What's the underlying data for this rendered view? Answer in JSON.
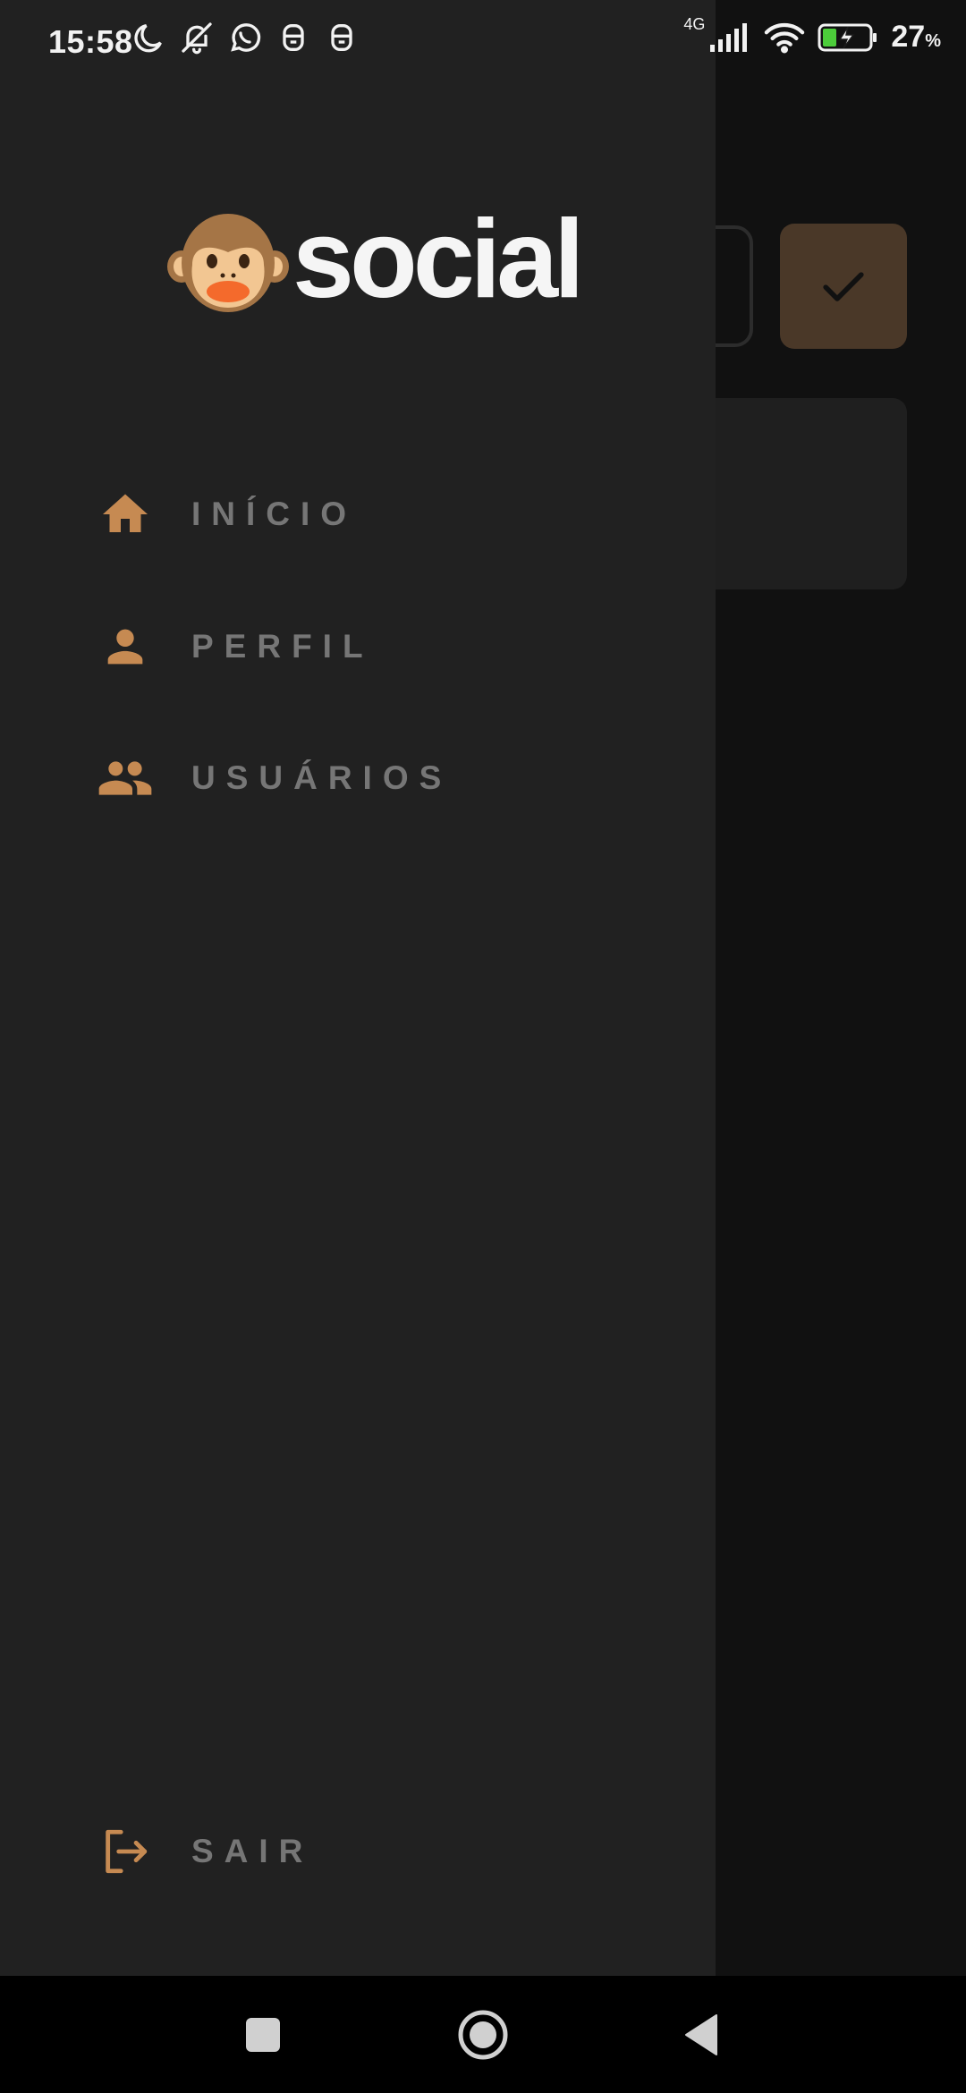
{
  "status_bar": {
    "time": "15:58",
    "network": "4G",
    "battery_percent": "27",
    "battery_unit": "%",
    "icons": [
      "moon-icon",
      "bell-off-icon",
      "whatsapp-icon",
      "app-notification-icon",
      "app-notification-icon"
    ]
  },
  "drawer": {
    "logo": {
      "emoji": "🐵",
      "text": "social"
    },
    "menu": [
      {
        "label": "INÍCIO",
        "icon": "home-icon"
      },
      {
        "label": "PERFIL",
        "icon": "person-icon"
      },
      {
        "label": "USUÁRIOS",
        "icon": "people-icon"
      }
    ],
    "logout": {
      "label": "SAIR",
      "icon": "logout-icon"
    }
  },
  "colors": {
    "accent": "#c68a52",
    "drawer_bg": "#212121",
    "menu_text": "#767676",
    "confirm_button": "#4a3828"
  },
  "nav_bar": {
    "buttons": [
      "recents-button",
      "home-button",
      "back-button"
    ]
  }
}
